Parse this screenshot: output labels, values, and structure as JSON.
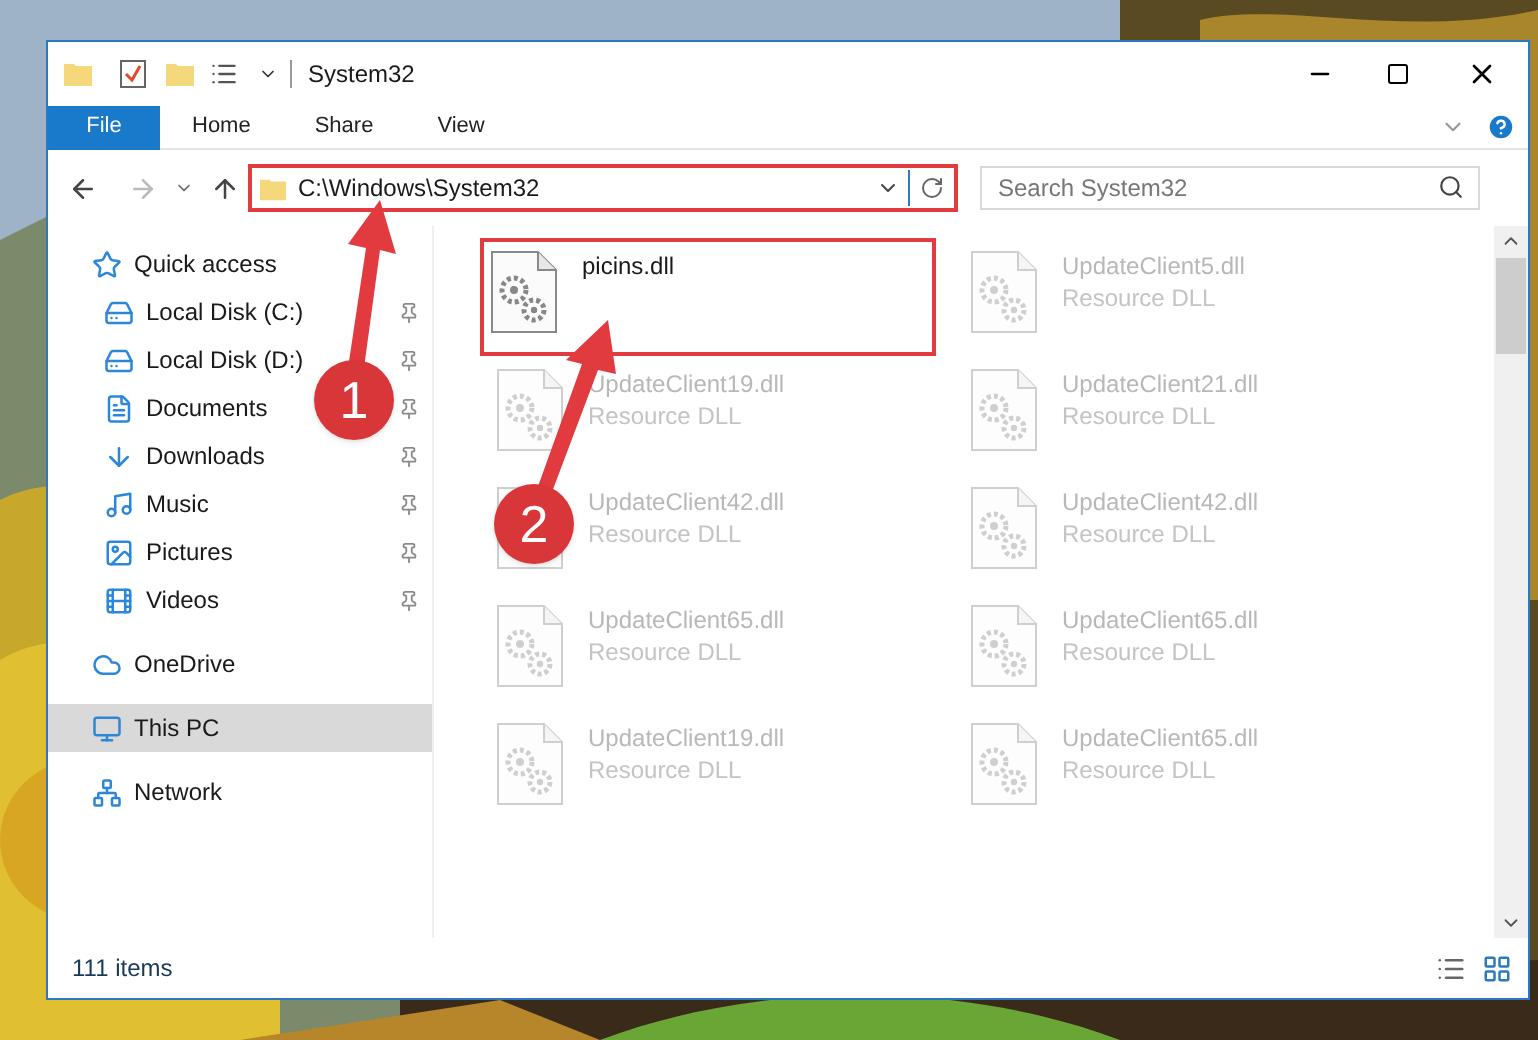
{
  "window": {
    "title": "System32"
  },
  "ribbon_tabs": [
    {
      "label": "File",
      "kind": "file"
    },
    {
      "label": "Home",
      "kind": "tab"
    },
    {
      "label": "Share",
      "kind": "tab"
    },
    {
      "label": "View",
      "kind": "tab"
    }
  ],
  "address_bar": {
    "path": "C:\\Windows\\System32",
    "highlighted": true
  },
  "search": {
    "placeholder": "Search System32"
  },
  "sidebar": {
    "items": [
      {
        "label": "Quick access",
        "selected": false,
        "children": [
          {
            "label": "Local Disk (C:)",
            "pinned": true,
            "selected": false
          },
          {
            "label": "Local Disk (D:)",
            "pinned": true,
            "selected": false
          },
          {
            "label": "Documents",
            "pinned": true,
            "selected": false
          },
          {
            "label": "Downloads",
            "pinned": true,
            "selected": false
          },
          {
            "label": "Music",
            "pinned": true,
            "selected": false
          },
          {
            "label": "Pictures",
            "pinned": true,
            "selected": false
          },
          {
            "label": "Videos",
            "pinned": true,
            "selected": false
          }
        ]
      },
      {
        "label": "OneDrive",
        "selected": false
      },
      {
        "label": "This PC",
        "selected": true
      },
      {
        "label": "Network",
        "selected": false
      }
    ]
  },
  "files": [
    {
      "name": "picins.dll",
      "highlighted": true,
      "faded": false
    },
    {
      "name": "UpdateClient5.dll",
      "type": "Resource DLL",
      "highlighted": false,
      "faded": true
    },
    {
      "name": "UpdateClient19.dll",
      "type": "Resource DLL",
      "highlighted": false,
      "faded": true
    },
    {
      "name": "UpdateClient21.dll",
      "type": "Resource DLL",
      "highlighted": false,
      "faded": true
    },
    {
      "name": "UpdateClient42.dll",
      "type": "Resource DLL",
      "highlighted": false,
      "faded": true
    },
    {
      "name": "UpdateClient42.dll",
      "type": "Resource DLL",
      "highlighted": false,
      "faded": true
    },
    {
      "name": "UpdateClient65.dll",
      "type": "Resource DLL",
      "highlighted": false,
      "faded": true
    },
    {
      "name": "UpdateClient65.dll",
      "type": "Resource DLL",
      "highlighted": false,
      "faded": true
    },
    {
      "name": "UpdateClient19.dll",
      "type": "Resource DLL",
      "highlighted": false,
      "faded": true
    },
    {
      "name": "UpdateClient65.dll",
      "type": "Resource DLL",
      "highlighted": false,
      "faded": true
    }
  ],
  "callouts": [
    {
      "label": "1"
    },
    {
      "label": "2"
    }
  ],
  "status_bar": {
    "item_count": "111 items"
  }
}
